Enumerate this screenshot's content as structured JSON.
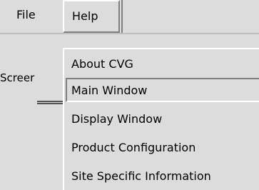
{
  "menubar": {
    "file_label": "File",
    "help_label": "Help"
  },
  "main": {
    "screen_label": "Screer"
  },
  "help_menu": {
    "items": [
      {
        "label": "About CVG"
      },
      {
        "label": "Main Window"
      },
      {
        "label": "Display Window"
      },
      {
        "label": "Product Configuration"
      },
      {
        "label": "Site Specific Information"
      }
    ]
  }
}
